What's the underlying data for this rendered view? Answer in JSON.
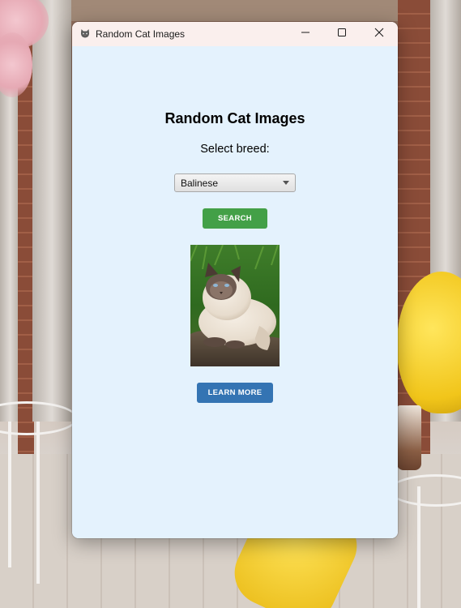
{
  "window": {
    "title": "Random Cat Images",
    "icon": "cat-icon"
  },
  "titlebar_controls": {
    "minimize_icon": "minimize-icon",
    "maximize_icon": "maximize-icon",
    "close_icon": "close-icon"
  },
  "main": {
    "heading": "Random Cat Images",
    "breed_label": "Select breed:",
    "breed_select": {
      "selected": "Balinese"
    },
    "search_button": "SEARCH",
    "learn_more_button": "LEARN MORE"
  },
  "colors": {
    "content_background": "#e4f2fd",
    "titlebar_background": "#faefed",
    "search_button": "#43a047",
    "learn_more_button": "#3474b3"
  }
}
